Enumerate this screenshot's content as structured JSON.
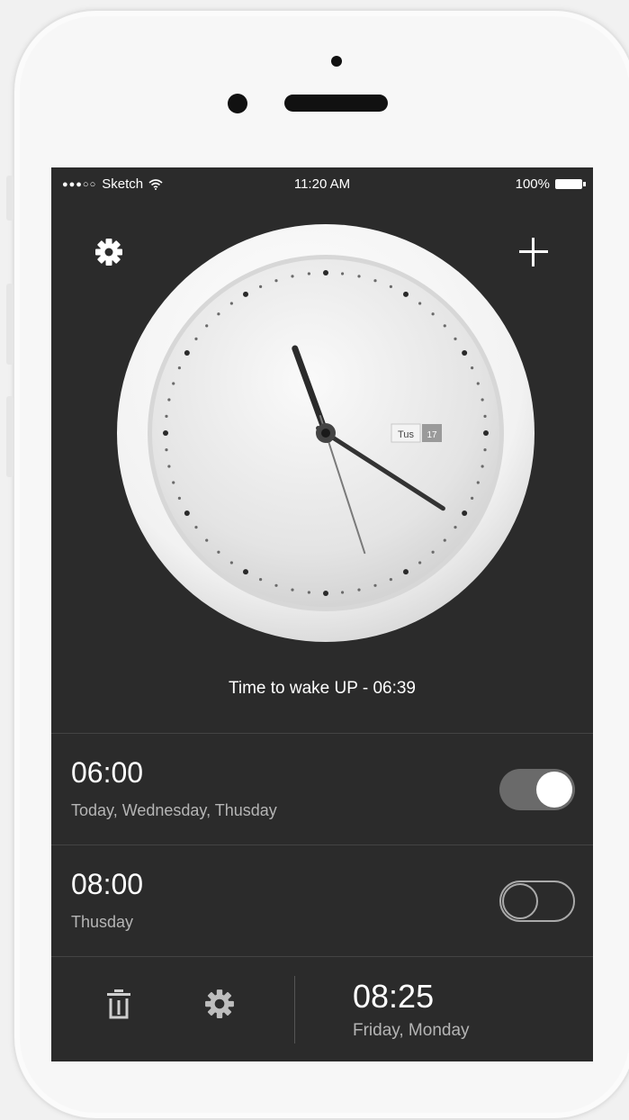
{
  "status": {
    "carrier": "Sketch",
    "time": "11:20 AM",
    "battery": "100%"
  },
  "clock": {
    "day_label": "Tus",
    "date_label": "17",
    "hour": 11,
    "minute": 20,
    "second": 27
  },
  "wake_message": "Time to wake UP - 06:39",
  "alarms": [
    {
      "time": "06:00",
      "days": "Today, Wednesday, Thusday",
      "enabled": true
    },
    {
      "time": "08:00",
      "days": "Thusday",
      "enabled": false
    }
  ],
  "next_alarm": {
    "time": "08:25",
    "days": "Friday, Monday"
  },
  "icons": {
    "top_left": "gear-icon",
    "top_right": "plus-icon",
    "bottom_left": "trash-icon",
    "bottom_middle": "gear-icon"
  },
  "colors": {
    "screen_bg": "#2b2b2b",
    "toggle_on": "#6a6a6a"
  }
}
